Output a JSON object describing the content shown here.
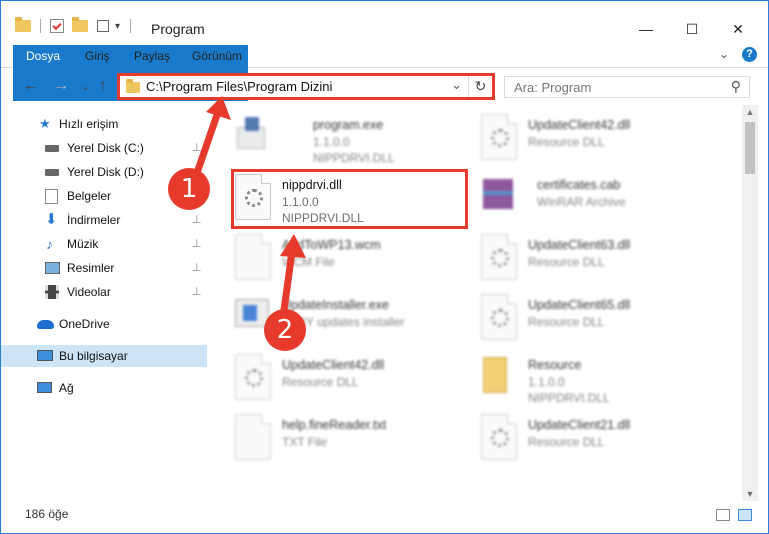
{
  "window": {
    "title": "Program",
    "minimize": "—",
    "maximize": "☐",
    "close": "✕"
  },
  "ribbon": {
    "tabs": [
      "Dosya",
      "Giriş",
      "Paylaş",
      "Görünüm"
    ],
    "expand": "⌄",
    "help": "?"
  },
  "nav": {
    "back": "←",
    "forward": "→",
    "recent": "⌄",
    "up": "↑",
    "address": "C:\\Program Files\\Program Dizini",
    "address_dropdown": "⌄",
    "refresh": "↻",
    "search_placeholder": "Ara: Program",
    "search_icon": "⚲"
  },
  "sidebar": {
    "items": [
      {
        "label": "Hızlı erişim",
        "icon": "star-icon"
      },
      {
        "label": "Yerel Disk (C:)",
        "icon": "drive-icon"
      },
      {
        "label": "Yerel Disk (D:)",
        "icon": "drive-icon"
      },
      {
        "label": "Belgeler",
        "icon": "documents-icon"
      },
      {
        "label": "İndirmeler",
        "icon": "download-icon"
      },
      {
        "label": "Müzik",
        "icon": "music-icon"
      },
      {
        "label": "Resimler",
        "icon": "pictures-icon"
      },
      {
        "label": "Videolar",
        "icon": "video-icon"
      },
      {
        "label": "OneDrive",
        "icon": "cloud-icon"
      },
      {
        "label": "Bu bilgisayar",
        "icon": "computer-icon"
      },
      {
        "label": "Ağ",
        "icon": "network-icon"
      }
    ],
    "pin": "📌"
  },
  "files": [
    {
      "name": "program.exe",
      "l2": "1.1.0.0",
      "l3": "NIPPDRVI.DLL"
    },
    {
      "name": "UpdateClient42.dll",
      "l2": "Resource DLL",
      "l3": ""
    },
    {
      "name": "nippdrvi.dll",
      "l2": "1.1.0.0",
      "l3": "NIPPDRVI.DLL"
    },
    {
      "name": "certificates.cab",
      "l2": "WinRAR Archive",
      "l3": ""
    },
    {
      "name": "AddToWP13.wcm",
      "l2": "WCM File",
      "l3": ""
    },
    {
      "name": "UpdateClient63.dll",
      "l2": "Resource DLL",
      "l3": ""
    },
    {
      "name": "UpdateInstaller.exe",
      "l2": "ABBY updates installer",
      "l3": ""
    },
    {
      "name": "UpdateClient65.dll",
      "l2": "Resource DLL",
      "l3": ""
    },
    {
      "name": "UpdateClient42.dll",
      "l2": "Resource DLL",
      "l3": ""
    },
    {
      "name": "Resource",
      "l2": "1.1.0.0",
      "l3": "NIPPDRVI.DLL"
    },
    {
      "name": "help.fineReader.txt",
      "l2": "TXT File",
      "l3": ""
    },
    {
      "name": "UpdateClient21.dll",
      "l2": "Resource DLL",
      "l3": ""
    }
  ],
  "status": {
    "count": "186 öğe"
  },
  "annotations": {
    "step1": "1",
    "step2": "2",
    "accent": "#e53a2c"
  }
}
